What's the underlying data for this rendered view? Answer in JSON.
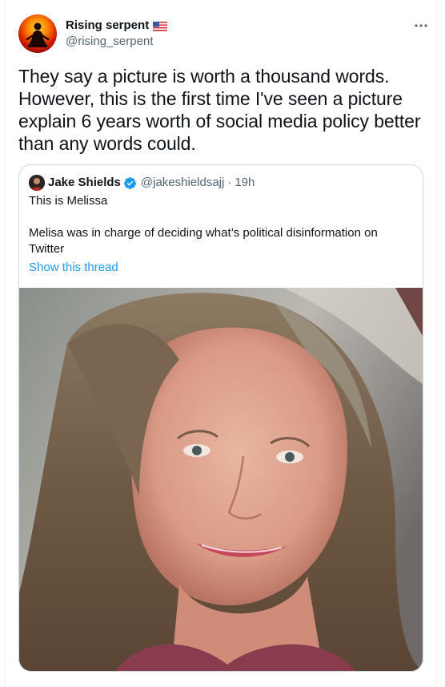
{
  "tweet": {
    "author": {
      "name": "Rising serpent",
      "handle": "@rising_serpent",
      "badge_icon": "us-flag-icon"
    },
    "more_icon": "more-icon",
    "text": "They say a picture is worth a thousand words. However, this is the first time I've seen a picture explain 6 years worth of social media policy better than any words could."
  },
  "quoted_tweet": {
    "author": {
      "name": "Jake Shields",
      "handle": "@jakeshieldsajj",
      "separator": "·",
      "time": "19h",
      "verified_icon": "verified-badge-icon"
    },
    "line1": "This is Melissa",
    "line2": "Melisa was in charge of deciding what’s political disinformation on Twitter",
    "show_thread": "Show this thread",
    "photo_icon": "photo"
  },
  "colors": {
    "text": "#0f1419",
    "secondary": "#536471",
    "link": "#1d9bf0",
    "border": "#cfd9de",
    "verified": "#1d9bf0"
  }
}
